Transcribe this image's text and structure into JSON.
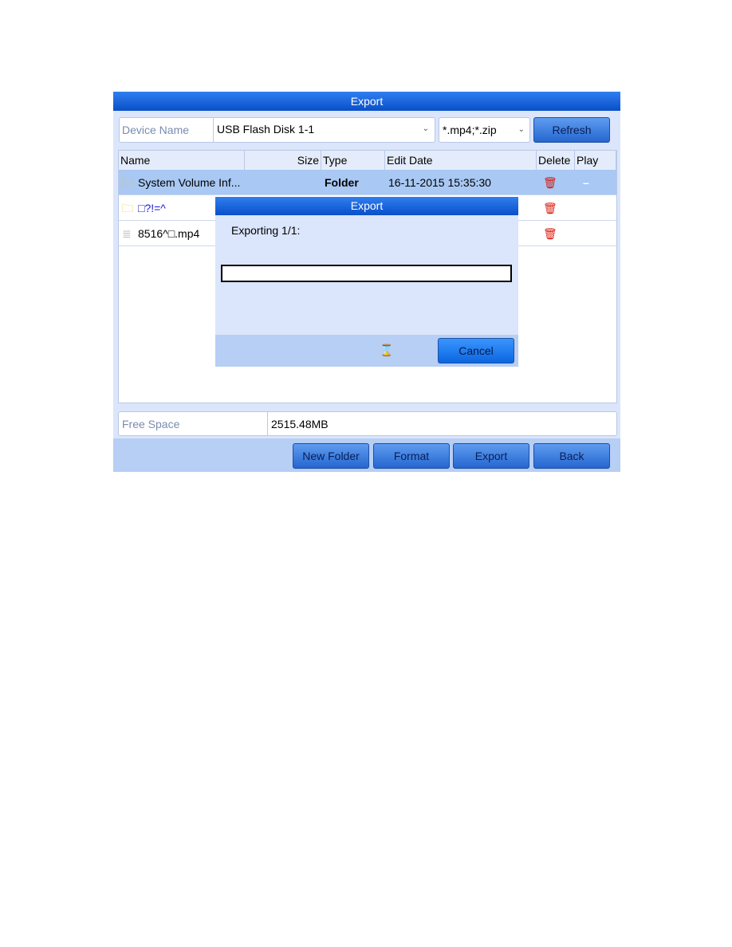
{
  "window": {
    "title": "Export"
  },
  "device": {
    "label": "Device Name",
    "value": "USB Flash Disk 1-1",
    "filter": "*.mp4;*.zip",
    "refresh_label": "Refresh"
  },
  "table": {
    "headers": [
      "Name",
      "Size",
      "Type",
      "Edit Date",
      "Delete",
      "Play"
    ],
    "rows": [
      {
        "name": "System Volume Inf...",
        "size": "",
        "type": "Folder",
        "date": "16-11-2015 15:35:30",
        "icon": "folder-icon",
        "play": "–",
        "selected": true
      },
      {
        "name": "□?!=^",
        "size": "",
        "type": "",
        "date": "",
        "icon": "folder-icon",
        "play": "",
        "selected": false
      },
      {
        "name": "8516^□.mp4",
        "size": "",
        "type": "",
        "date": "",
        "icon": "file-icon",
        "play": "",
        "selected": false
      }
    ]
  },
  "free_space": {
    "label": "Free Space",
    "value": "2515.48MB"
  },
  "buttons": {
    "new_folder": "New Folder",
    "format": "Format",
    "export": "Export",
    "back": "Back"
  },
  "dialog": {
    "title": "Export",
    "status": "Exporting 1/1:",
    "progress": 0,
    "cancel_label": "Cancel"
  },
  "colors": {
    "accent": "#1565e0",
    "delete": "#d81b0e",
    "selected_row": "#a9c8f3"
  }
}
